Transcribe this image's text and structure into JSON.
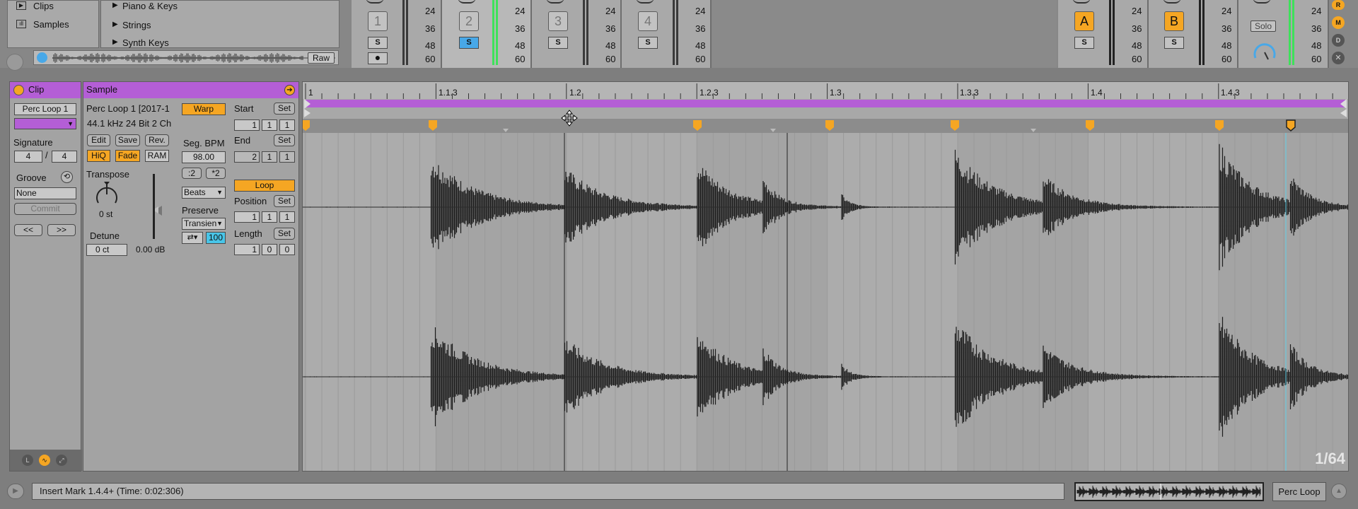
{
  "browser": {
    "places": [
      {
        "label": "Clips",
        "icon": "clip-icon"
      },
      {
        "label": "Samples",
        "icon": "waveform-icon"
      }
    ],
    "folders": [
      "Piano & Keys",
      "Strings",
      "Synth Keys"
    ],
    "raw_label": "Raw"
  },
  "mixer": {
    "db_scale": [
      "24",
      "36",
      "48",
      "60"
    ],
    "tracks": [
      {
        "number": "1",
        "solo": "S",
        "solo_active": false,
        "arm": true
      },
      {
        "number": "2",
        "solo": "S",
        "solo_active": true,
        "arm": false
      },
      {
        "number": "3",
        "solo": "S",
        "solo_active": false,
        "arm": false
      },
      {
        "number": "4",
        "solo": "S",
        "solo_active": false,
        "arm": false
      }
    ],
    "returns": [
      {
        "label": "A",
        "solo": "S"
      },
      {
        "label": "B",
        "solo": "S"
      }
    ],
    "master": {
      "solo_label": "Solo"
    },
    "side_buttons": [
      "R",
      "M",
      "D"
    ]
  },
  "clip": {
    "title": "Clip",
    "name": "Perc Loop 1",
    "signature_label": "Signature",
    "sig_num": "4",
    "sig_sep": "/",
    "sig_den": "4",
    "groove_label": "Groove",
    "groove_value": "None",
    "commit_label": "Commit",
    "prev_label": "<<",
    "next_label": ">>"
  },
  "sample": {
    "title": "Sample",
    "file_name": "Perc Loop 1 [2017-1",
    "file_info": "44.1 kHz 24 Bit 2 Ch",
    "edit_label": "Edit",
    "save_label": "Save",
    "rev_label": "Rev.",
    "hiq_label": "HiQ",
    "fade_label": "Fade",
    "ram_label": "RAM",
    "transpose_label": "Transpose",
    "transpose_value": "0 st",
    "detune_label": "Detune",
    "detune_value": "0 ct",
    "gain_value": "0.00 dB",
    "warp_label": "Warp",
    "seg_bpm_label": "Seg. BPM",
    "seg_bpm_value": "98.00",
    "half_label": ":2",
    "double_label": "*2",
    "warp_mode": "Beats",
    "preserve_label": "Preserve",
    "preserve_value": "Transient",
    "loop_mode_icon": "loop-mode-icon",
    "envelope_value": "100",
    "start_label": "Start",
    "set_label": "Set",
    "start_values": [
      "1",
      "1",
      "1"
    ],
    "end_label": "End",
    "end_values": [
      "2",
      "1",
      "1"
    ],
    "loop_label": "Loop",
    "position_label": "Position",
    "position_values": [
      "1",
      "1",
      "1"
    ],
    "length_label": "Length",
    "length_values": [
      "1",
      "0",
      "0"
    ]
  },
  "editor": {
    "ruler": [
      "1",
      "1.1.3",
      "1.2",
      "1.2.3",
      "1.3",
      "1.3.3",
      "1.4",
      "1.4.3"
    ],
    "zoom": "1/64"
  },
  "status": {
    "message": "Insert Mark 1.4.4+ (Time: 0:02:306)",
    "track_label": "Perc Loop"
  },
  "colors": {
    "accent": "#f5a623",
    "clip": "#b45ed6",
    "solo_active": "#48a8e8",
    "meter": "#3ee15a",
    "playhead": "#5fd0e8"
  }
}
